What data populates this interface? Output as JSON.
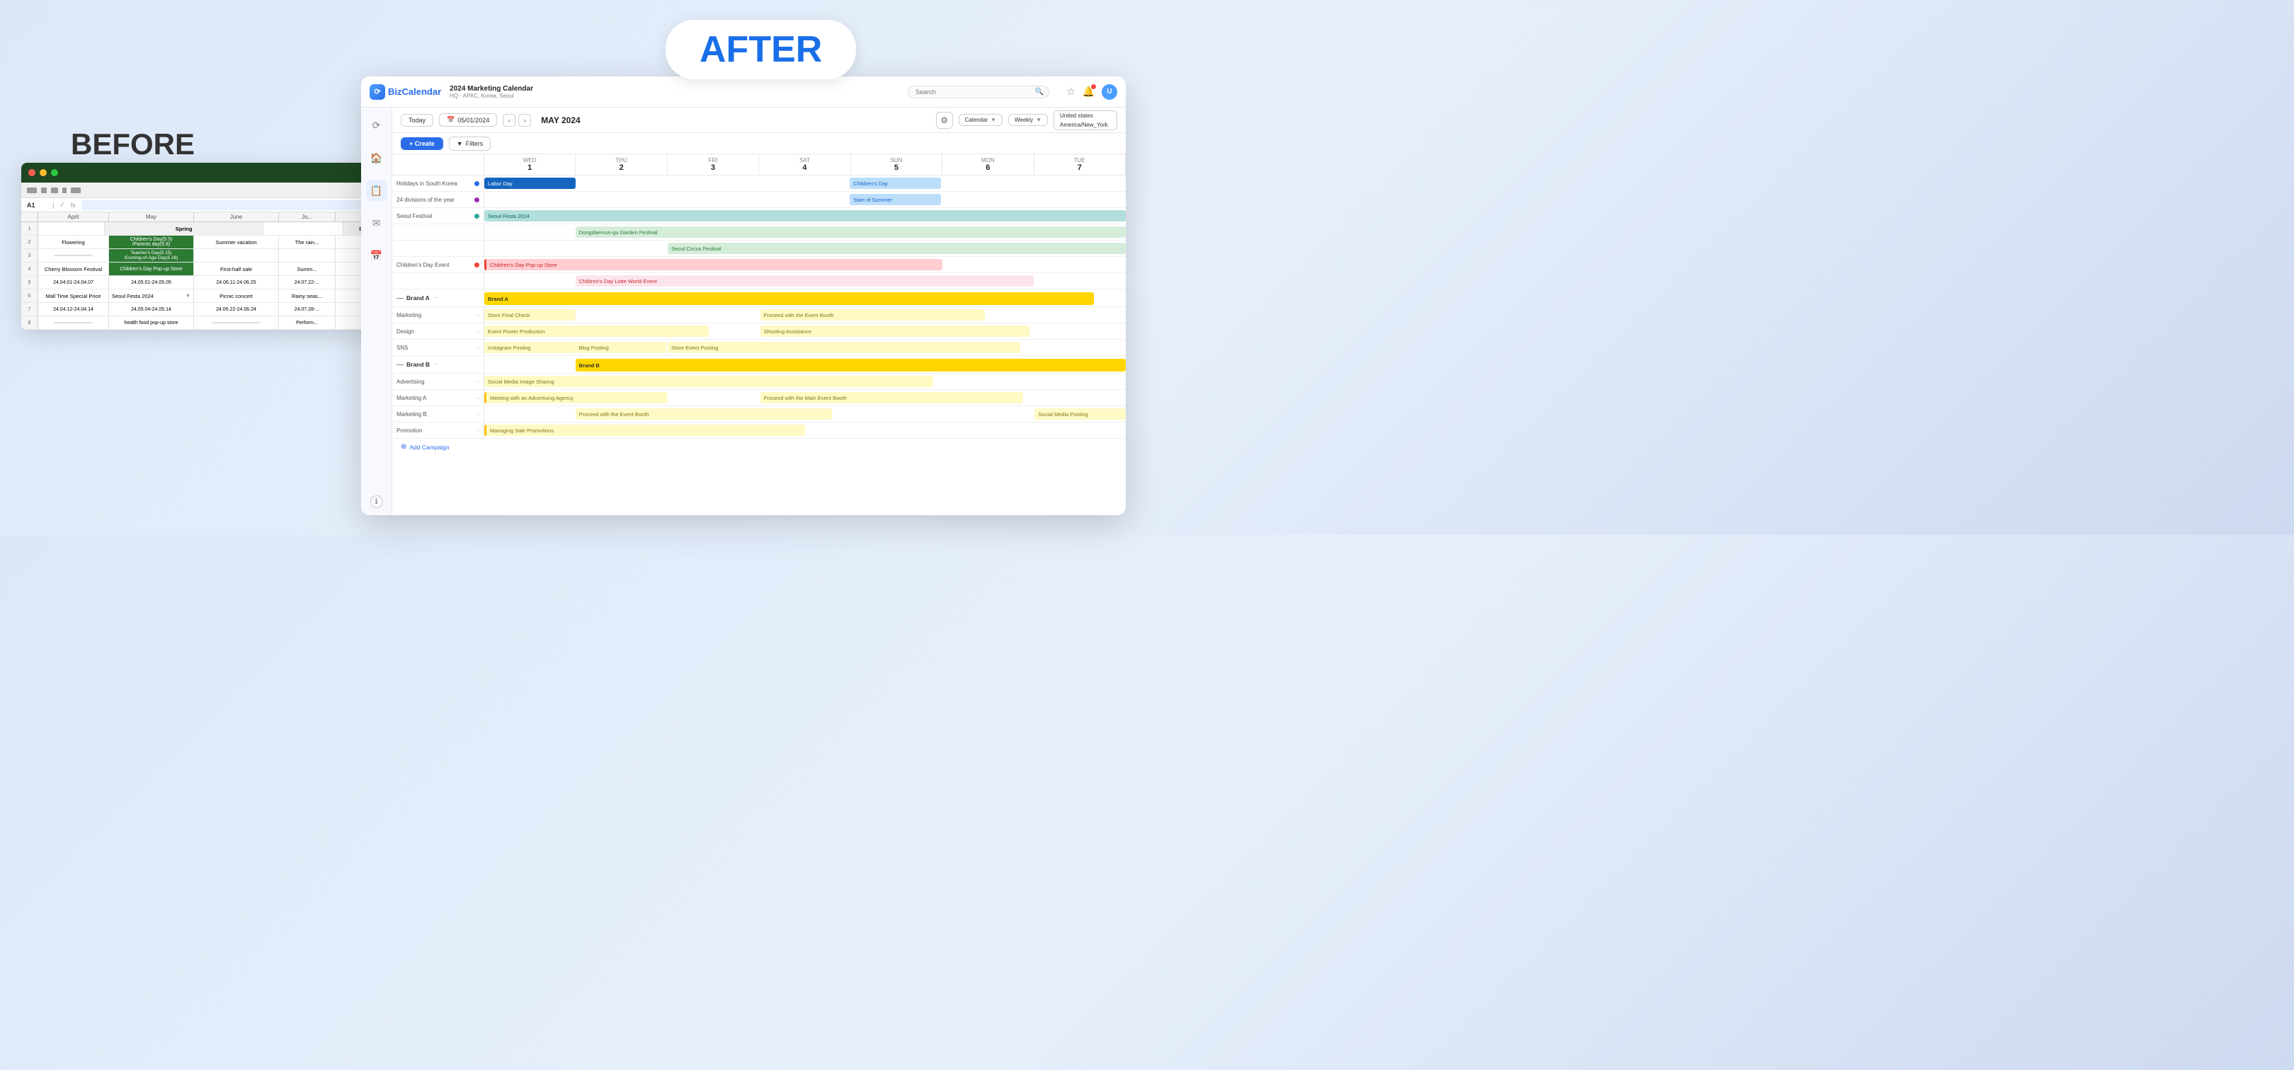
{
  "after_badge": "AFTER",
  "before_label": "BEFORE",
  "app": {
    "logo": "BizCalendar",
    "header_title": "2024 Marketing Calendar",
    "header_subtitle": "HQ · APAC, Korea, Seoul",
    "search_placeholder": "Search",
    "today_btn": "Today",
    "date_btn": "05/01/2024",
    "month_title": "MAY 2024",
    "calendar_select": "Calendar",
    "weekly_select": "Weekly",
    "country_name": "United states",
    "country_tz": "America/New_York",
    "create_btn": "+ Create",
    "filters_btn": "Filters"
  },
  "days": [
    {
      "name": "WED",
      "num": "1"
    },
    {
      "name": "THU",
      "num": "2"
    },
    {
      "name": "FRI",
      "num": "3"
    },
    {
      "name": "SAT",
      "num": "4"
    },
    {
      "name": "SUN",
      "num": "5"
    },
    {
      "name": "MON",
      "num": "6"
    },
    {
      "name": "TUE",
      "num": "7"
    }
  ],
  "rows": {
    "holidays_label": "Holidays in South Korea",
    "divisions_label": "24 divisions of the year",
    "seoul_festival_label": "Seoul Festival",
    "childrens_day_label": "Children's Day Event",
    "brand_a_label": "Brand A",
    "brand_b_label": "Brand B",
    "marketing_label": "Marketing",
    "design_label": "Design",
    "sns_label": "SNS",
    "advertising_label": "Advertising",
    "marketing_a_label": "Marketing A",
    "marketing_b_label": "Marketing B",
    "promotion_label": "Promotion"
  },
  "events": {
    "labor_day": "Labor Day",
    "childrens_day": "Children's Day",
    "start_of_summer": "Start of Summer",
    "seoul_festa": "Seoul Festa 2024",
    "dongdaemun": "Dongdaemun-gu Garden Festival",
    "seoul_circus": "Seoul Circus Festival",
    "childrens_popup": "Children's Day Pop-up Store",
    "childrens_lotte": "Children's Day Lotte World Event",
    "brand_a": "Brand A",
    "store_final_check": "Store Final Check",
    "event_poster": "Event Poster Production",
    "shooting_assistance": "Shooting Assistance",
    "instagram_posting": "Instagram Posting",
    "blog_posting": "Blog Posting",
    "store_event_posting": "Store Event Posting",
    "brand_b": "Brand B",
    "social_media": "Social Media Image Sharing",
    "meeting_agency": "Meeting with an Advertising Agency",
    "proceed_main": "Proceed with the Main Event Booth",
    "marketing_b_proceed": "Proceed with the Event Booth",
    "social_media_posting": "Social Media Posting",
    "managing_sale": "Managing Sale Promotions",
    "proceed_event_booth": "Proceed with the Event Booth",
    "add_campaign": "Add Campaign"
  },
  "sidebar_icons": [
    "sync",
    "home",
    "file",
    "mail",
    "calendar"
  ],
  "excel": {
    "col_a_width": 100,
    "headers": [
      "April",
      "May",
      "June",
      "Ju..."
    ],
    "season_spring": "Spring",
    "season_summer": "Summer",
    "row2": {
      "a": "Flowering",
      "b": "Children's Day(5.5)\n/Parents day(5.8)",
      "c": "Summer vacation",
      "d": "The rain..."
    },
    "row3": {
      "b": "Teacher's Day(5.15)\n/Coming-of-Age Day(5.16)"
    },
    "row4": {
      "a": "Cherry Blossom Festival",
      "b": "Children's Day Pop-up Store",
      "c": "First-half sale",
      "d": "Summ..."
    },
    "row5": {
      "a": "24.04.01-24.04.07",
      "b": "24.05.01-24.05.05",
      "c": "24.06.11-24.06.25",
      "d": "24.07.22-..."
    },
    "row6": {
      "a": "Mall Time Special Price",
      "b": "Seoul Festa 2024",
      "c": "Picnic concert",
      "d": "Rainy seas..."
    },
    "row7": {
      "a": "24.04.12-24.04.14",
      "b": "24.05.04-24.05.14",
      "c": "24.06.22-24.06.24",
      "d": "24.07.28-..."
    },
    "row8": {
      "b": "health food pop-up store",
      "d": "Perform..."
    }
  }
}
